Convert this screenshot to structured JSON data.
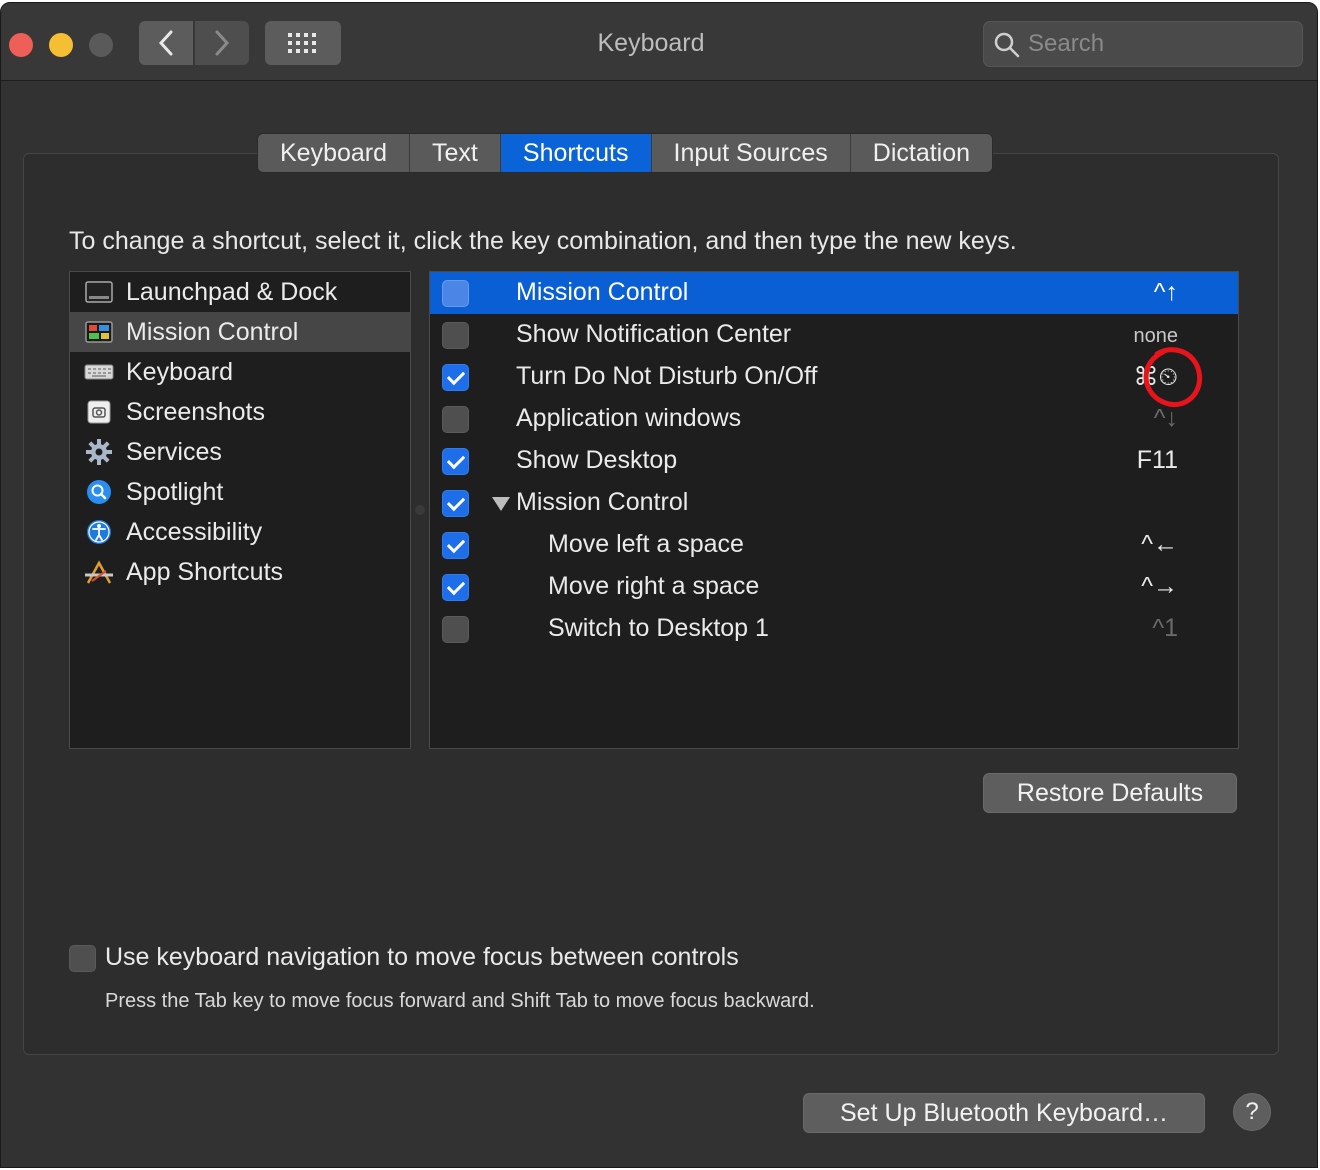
{
  "window": {
    "title": "Keyboard"
  },
  "toolbar": {
    "search_placeholder": "Search"
  },
  "tabs": [
    {
      "label": "Keyboard",
      "active": false
    },
    {
      "label": "Text",
      "active": false
    },
    {
      "label": "Shortcuts",
      "active": true
    },
    {
      "label": "Input Sources",
      "active": false
    },
    {
      "label": "Dictation",
      "active": false
    }
  ],
  "instruction": "To change a shortcut, select it, click the key combination, and then type the new keys.",
  "categories": [
    {
      "label": "Launchpad & Dock",
      "icon": "launchpad-icon"
    },
    {
      "label": "Mission Control",
      "icon": "mission-control-icon",
      "selected": true
    },
    {
      "label": "Keyboard",
      "icon": "keyboard-icon"
    },
    {
      "label": "Screenshots",
      "icon": "screenshots-icon"
    },
    {
      "label": "Services",
      "icon": "gear-icon"
    },
    {
      "label": "Spotlight",
      "icon": "spotlight-icon"
    },
    {
      "label": "Accessibility",
      "icon": "accessibility-icon"
    },
    {
      "label": "App Shortcuts",
      "icon": "app-shortcuts-icon"
    }
  ],
  "shortcuts": [
    {
      "label": "Mission Control",
      "checked": false,
      "keys": "^↑",
      "selected": true
    },
    {
      "label": "Show Notification Center",
      "checked": false,
      "keys": "none"
    },
    {
      "label": "Turn Do Not Disturb On/Off",
      "checked": true,
      "keys": "⌘⏲"
    },
    {
      "label": "Application windows",
      "checked": false,
      "keys": "^↓"
    },
    {
      "label": "Show Desktop",
      "checked": true,
      "keys": "F11"
    },
    {
      "label": "Mission Control",
      "checked": true,
      "keys": "",
      "group": true
    },
    {
      "label": "Move left a space",
      "checked": true,
      "keys": "^←",
      "indent": true
    },
    {
      "label": "Move right a space",
      "checked": true,
      "keys": "^→",
      "indent": true
    },
    {
      "label": "Switch to Desktop 1",
      "checked": false,
      "keys": "^1",
      "indent": true
    }
  ],
  "buttons": {
    "restore_defaults": "Restore Defaults",
    "bluetooth": "Set Up Bluetooth Keyboard…",
    "help": "?"
  },
  "keyboard_navigation": {
    "label": "Use keyboard navigation to move focus between controls",
    "checked": false,
    "hint": "Press the Tab key to move focus forward and Shift Tab to move focus backward."
  },
  "colors": {
    "accent": "#0a64d8",
    "annotation": "#e8141c"
  }
}
